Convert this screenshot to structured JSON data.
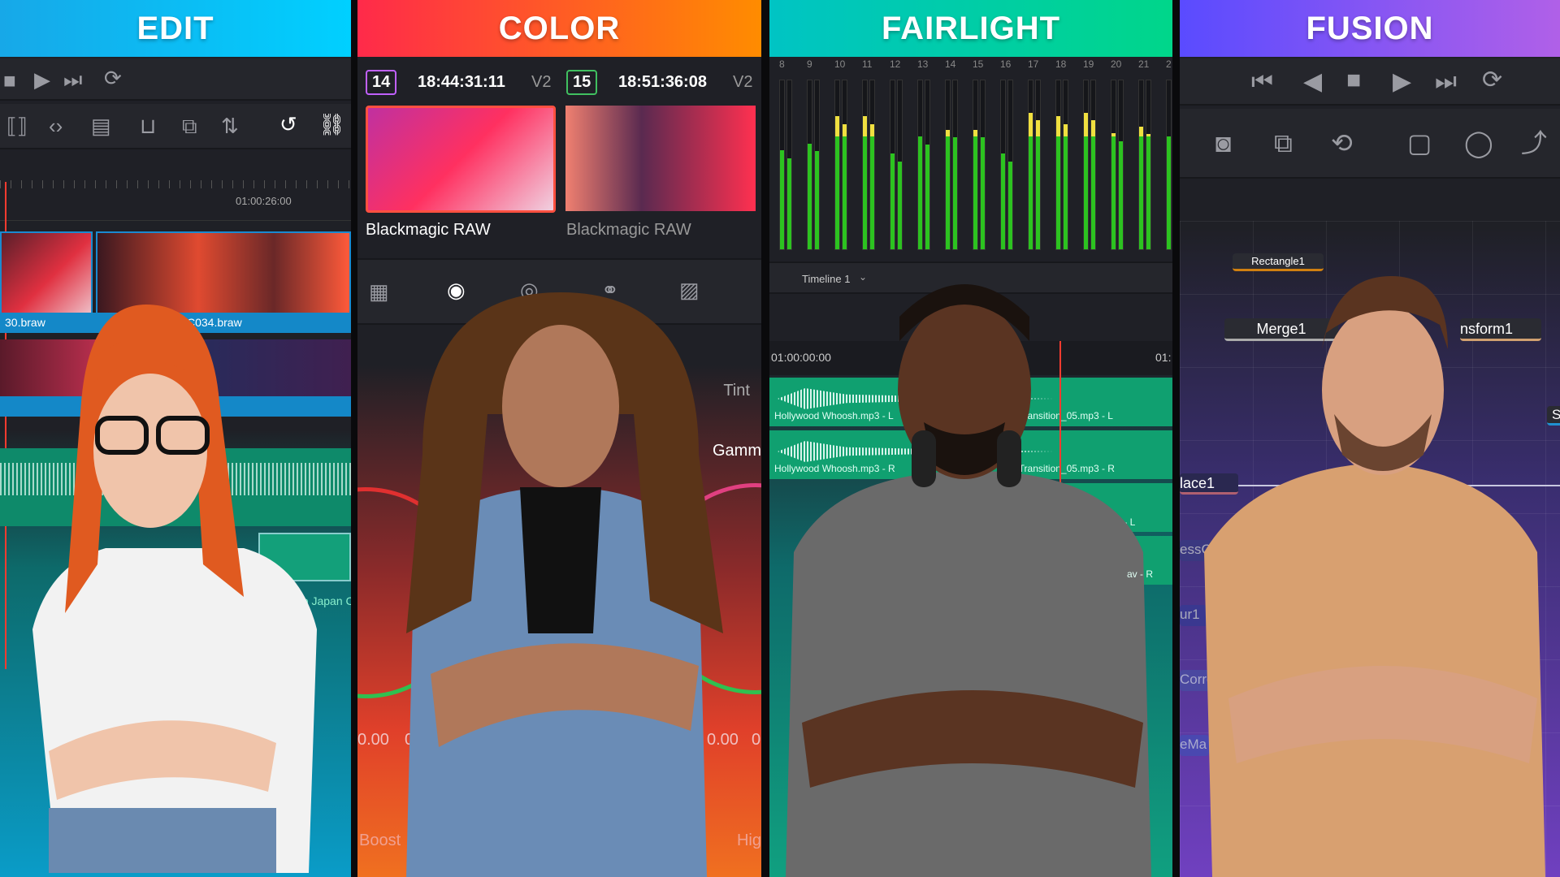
{
  "panels": {
    "edit": {
      "title": "EDIT",
      "header_gradient": [
        "#17a8e8",
        "#00d0ff"
      ],
      "ruler_timecode": "01:00:26:00",
      "clips": [
        "30.braw",
        "C034.braw"
      ],
      "audio_clip": "okyo Japan C",
      "toolbar_icons": [
        "stop-icon",
        "play-icon",
        "skip-forward-icon",
        "loop-icon"
      ],
      "edit_icons": [
        "trim-icon",
        "dynamic-trim-icon",
        "blade-icon",
        "insert-icon",
        "overwrite-icon",
        "replace-icon",
        "snapping-icon",
        "link-icon"
      ]
    },
    "color": {
      "title": "COLOR",
      "header_gradient": [
        "#ff2a4a",
        "#ff8c00"
      ],
      "clip1": {
        "number": "14",
        "timecode": "18:44:31:11",
        "track": "V2",
        "label": "Blackmagic RAW"
      },
      "clip2": {
        "number": "15",
        "timecode": "18:51:36:08",
        "track": "V2",
        "label": "Blackmagic RAW"
      },
      "params": {
        "tint": "Tint",
        "gamma": "Gamm",
        "boost": "Boost",
        "high": "Hig"
      },
      "values": [
        "0.00",
        "0.0",
        "0.00",
        "0"
      ]
    },
    "fairlight": {
      "title": "FAIRLIGHT",
      "header_gradient": [
        "#00c4c4",
        "#00d68a"
      ],
      "channels": [
        "8",
        "9",
        "10",
        "11",
        "12",
        "13",
        "14",
        "15",
        "16",
        "17",
        "18",
        "19",
        "20",
        "21",
        "2"
      ],
      "meter_levels": [
        0.58,
        0.62,
        0.78,
        0.78,
        0.56,
        0.66,
        0.7,
        0.7,
        0.56,
        0.8,
        0.78,
        0.8,
        0.68,
        0.72,
        0.66
      ],
      "timeline_name": "Timeline 1",
      "ruler_start": "01:00:00:00",
      "ruler_next": "01:",
      "clips": [
        "Hollywood Whoosh.mp3 - L",
        "Hollywood Whoosh.mp3 - R",
        "_Transition_05.mp3 - L",
        "_Transition_05.mp3 - R",
        "de.wav - L",
        "av - R"
      ]
    },
    "fusion": {
      "title": "FUSION",
      "header_gradient": [
        "#5a4bff",
        "#b060e8"
      ],
      "transport_icons": [
        "skip-back-icon",
        "step-back-icon",
        "stop-icon",
        "play-icon",
        "skip-forward-icon",
        "loop-icon"
      ],
      "nodes": [
        "Rectangle1",
        "Merge1",
        "nsform1",
        "lace1",
        "essCo...",
        "ur1",
        "Corre",
        "eMa",
        "S"
      ]
    }
  }
}
